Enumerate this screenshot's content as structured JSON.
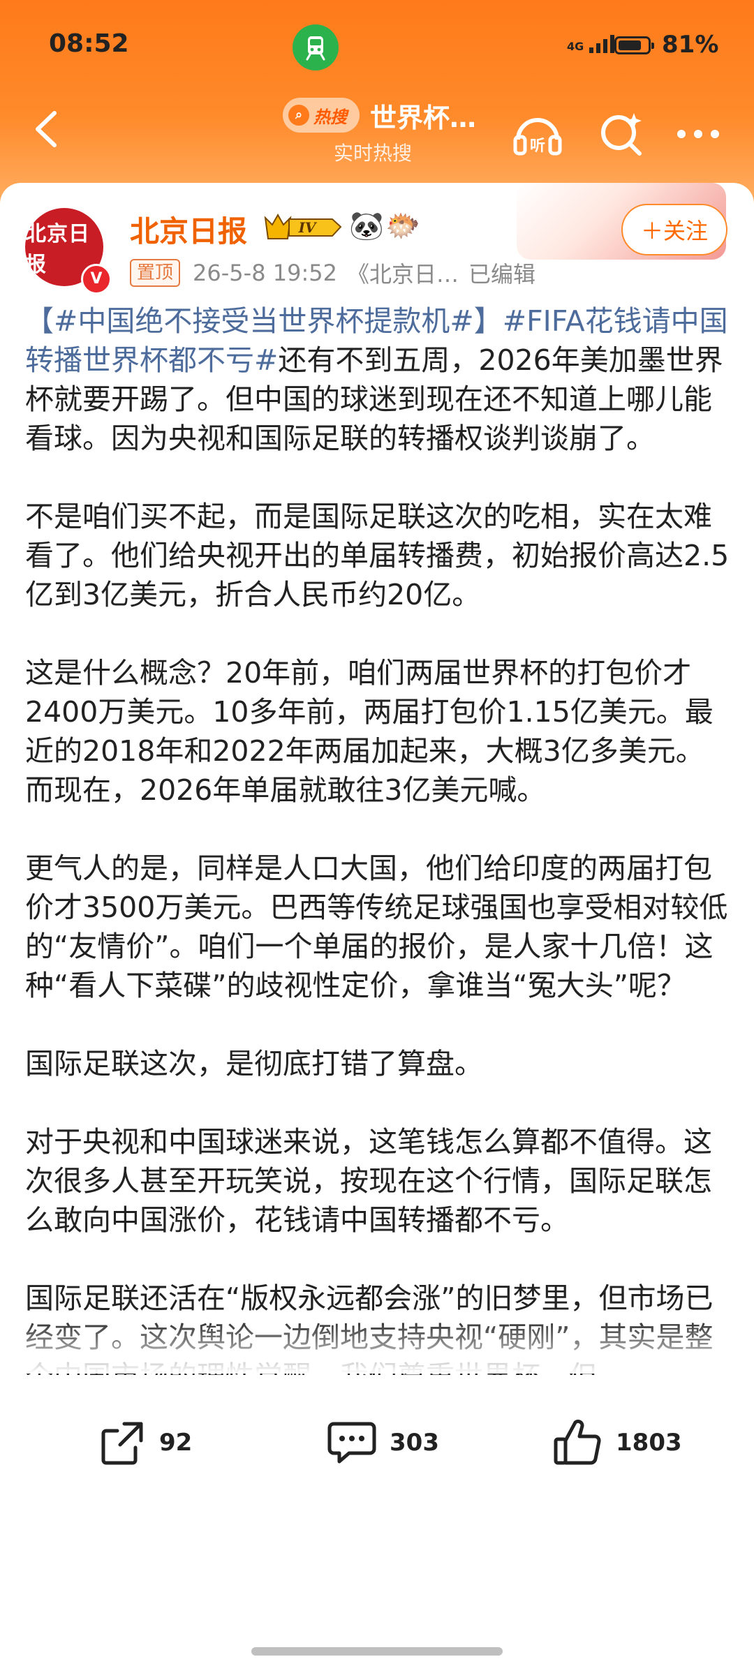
{
  "status_bar": {
    "time": "08:52",
    "signal": "4G",
    "battery_text": "81%",
    "battery_level": 0.81
  },
  "nav": {
    "hot_badge": "热搜",
    "title": "世界杯…",
    "subtitle": "实时热搜"
  },
  "post": {
    "author": "北京日报",
    "avatar_text": "北京日报",
    "level_badge": "IV",
    "pinned": "置顶",
    "date": "26-5-8 19:52",
    "source": "《北京日…",
    "edited": "已编辑",
    "follow": "＋关注",
    "paragraphs": [
      [
        {
          "text": "【#中国绝不接受当世界杯提款机#】",
          "tag": true
        },
        {
          "text": "#FIFA花钱请中国转播世界杯都不亏#",
          "tag": true
        },
        {
          "text": "还有不到五周，2026年美加墨世界杯就要开踢了。但中国的球迷到现在还不知道上哪儿能看球。因为央视和国际足联的转播权谈判谈崩了。",
          "tag": false
        }
      ],
      [
        {
          "text": "不是咱们买不起，而是国际足联这次的吃相，实在太难看了。他们给央视开出的单届转播费，初始报价高达2.5亿到3亿美元，折合人民币约20亿。",
          "tag": false
        }
      ],
      [
        {
          "text": "这是什么概念？20年前，咱们两届世界杯的打包价才2400万美元。10多年前，两届打包价1.15亿美元。最近的2018年和2022年两届加起来，大概3亿多美元。而现在，2026年单届就敢往3亿美元喊。",
          "tag": false
        }
      ],
      [
        {
          "text": "更气人的是，同样是人口大国，他们给印度的两届打包价才3500万美元。巴西等传统足球强国也享受相对较低的“友情价”。咱们一个单届的报价，是人家十几倍！这种“看人下菜碟”的歧视性定价，拿谁当“冤大头”呢？",
          "tag": false
        }
      ],
      [
        {
          "text": "国际足联这次，是彻底打错了算盘。",
          "tag": false
        }
      ],
      [
        {
          "text": "对于央视和中国球迷来说，这笔钱怎么算都不值得。这次很多人甚至开玩笑说，按现在这个行情，国际足联怎么敢向中国涨价，花钱请中国转播都不亏。",
          "tag": false
        }
      ],
      [
        {
          "text": "国际足联还活在“版权永远都会涨”的旧梦里，但市场已经变了。这次舆论一边倒地支持央视“硬刚”，其实是整个中国市场的理性觉醒。我们尊重世界杯，但",
          "tag": false
        }
      ]
    ]
  },
  "actions": {
    "share_count": "92",
    "comment_count": "303",
    "like_count": "1803"
  },
  "colors": {
    "header": "#ff7a1a",
    "author": "#f06200",
    "hashtag": "#4d6c9c",
    "train": "#2bb24c"
  }
}
